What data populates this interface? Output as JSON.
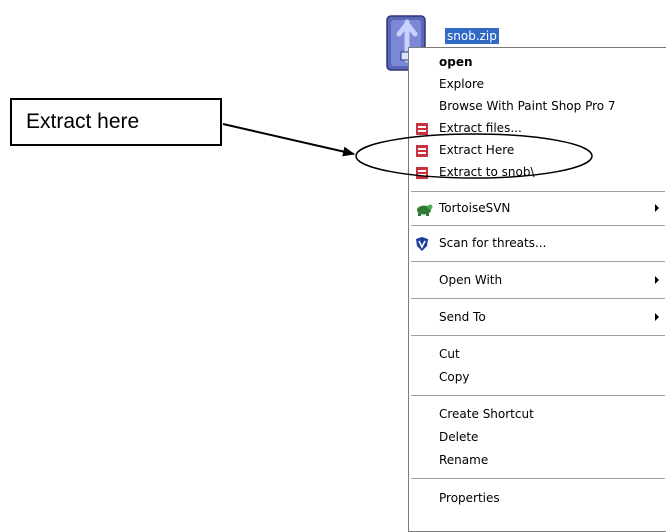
{
  "file": {
    "name": "snob.zip",
    "icon": "archive-file-icon"
  },
  "callout": {
    "text": "Extract here"
  },
  "menu": {
    "items": [
      {
        "label": "open",
        "bold": true
      },
      {
        "label": "Explore"
      },
      {
        "label": "Browse With Paint Shop Pro 7"
      },
      {
        "label": "Extract files...",
        "icon": "archive-icon"
      },
      {
        "label": "Extract Here",
        "icon": "archive-icon"
      },
      {
        "label": "Extract to snob\\",
        "icon": "archive-icon"
      },
      {
        "label": "TortoiseSVN",
        "icon": "tortoisesvn-icon",
        "submenu": true
      },
      {
        "label": "Scan for threats...",
        "icon": "shield-icon"
      },
      {
        "label": "Open With",
        "submenu": true
      },
      {
        "label": "Send To",
        "submenu": true
      },
      {
        "label": "Cut"
      },
      {
        "label": "Copy"
      },
      {
        "label": "Create Shortcut"
      },
      {
        "label": "Delete"
      },
      {
        "label": "Rename"
      },
      {
        "label": "Properties"
      }
    ]
  },
  "colors": {
    "selection": "#316ac5",
    "archive_icon": "#c8323c",
    "shield_icon": "#1a3f9e"
  }
}
